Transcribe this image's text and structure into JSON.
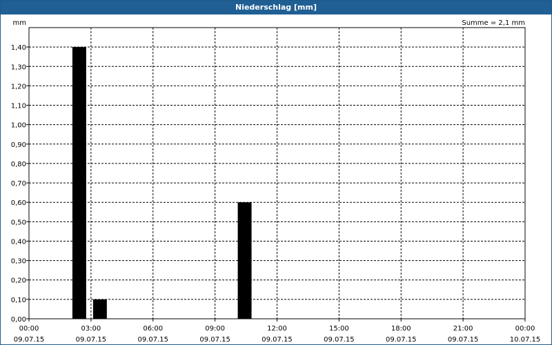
{
  "window": {
    "title": "Niederschlag [mm]"
  },
  "chart_data": {
    "type": "bar",
    "title": "Niederschlag [mm]",
    "ylabel": "mm",
    "xlabel": "",
    "summary": "Summe = 2,1 mm",
    "ylim": [
      0,
      1.5
    ],
    "yticks": [
      "0,00",
      "0,10",
      "0,20",
      "0,30",
      "0,40",
      "0,50",
      "0,60",
      "0,70",
      "0,80",
      "0,90",
      "1,00",
      "1,10",
      "1,20",
      "1,30",
      "1,40"
    ],
    "xlim_hours": [
      0,
      24
    ],
    "xticks": [
      {
        "time": "00:00",
        "date": "09.07.15"
      },
      {
        "time": "03:00",
        "date": "09.07.15"
      },
      {
        "time": "06:00",
        "date": "09.07.15"
      },
      {
        "time": "09:00",
        "date": "09.07.15"
      },
      {
        "time": "12:00",
        "date": "09.07.15"
      },
      {
        "time": "15:00",
        "date": "09.07.15"
      },
      {
        "time": "18:00",
        "date": "09.07.15"
      },
      {
        "time": "21:00",
        "date": "09.07.15"
      },
      {
        "time": "00:00",
        "date": "10.07.15"
      }
    ],
    "bars": [
      {
        "start": "09.07.15 02:00",
        "end": "09.07.15 03:00",
        "value": 1.4
      },
      {
        "start": "09.07.15 03:00",
        "end": "09.07.15 04:00",
        "value": 0.1
      },
      {
        "start": "09.07.15 10:00",
        "end": "09.07.15 11:00",
        "value": 0.6
      }
    ],
    "grid": true,
    "bar_color": "#000000"
  }
}
